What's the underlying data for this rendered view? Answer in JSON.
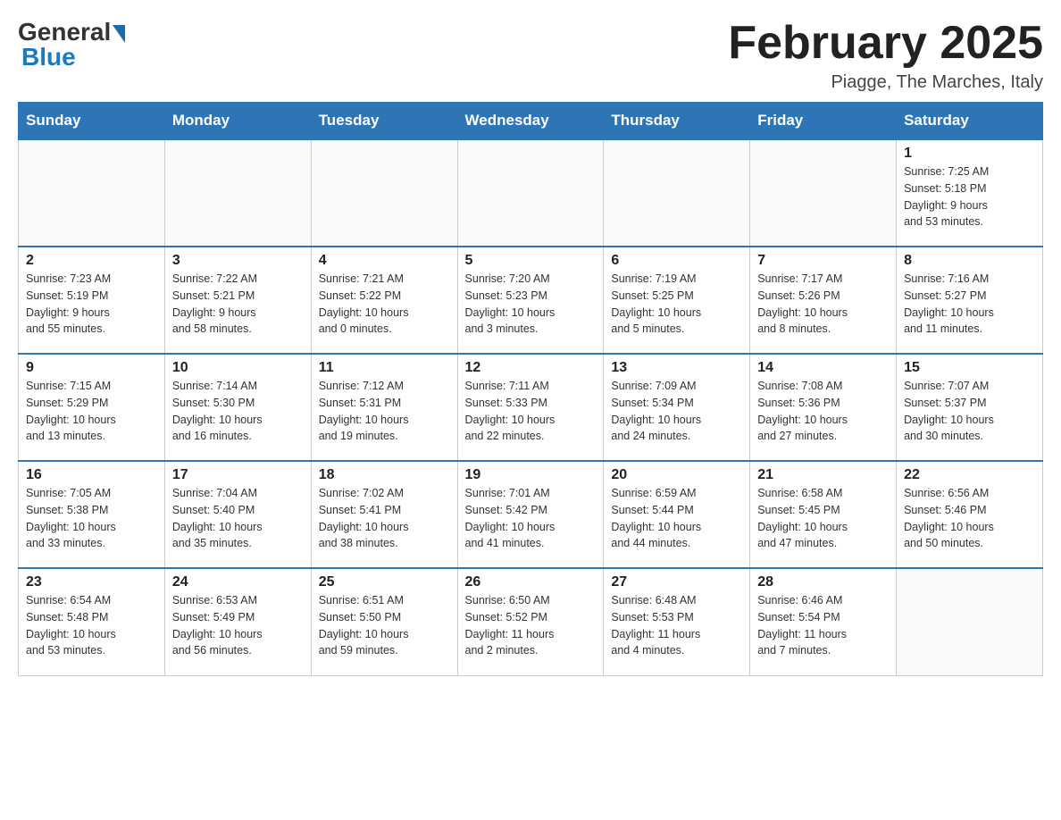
{
  "header": {
    "logo_general": "General",
    "logo_blue": "Blue",
    "month_title": "February 2025",
    "location": "Piagge, The Marches, Italy"
  },
  "weekdays": [
    "Sunday",
    "Monday",
    "Tuesday",
    "Wednesday",
    "Thursday",
    "Friday",
    "Saturday"
  ],
  "weeks": [
    [
      {
        "day": "",
        "info": ""
      },
      {
        "day": "",
        "info": ""
      },
      {
        "day": "",
        "info": ""
      },
      {
        "day": "",
        "info": ""
      },
      {
        "day": "",
        "info": ""
      },
      {
        "day": "",
        "info": ""
      },
      {
        "day": "1",
        "info": "Sunrise: 7:25 AM\nSunset: 5:18 PM\nDaylight: 9 hours\nand 53 minutes."
      }
    ],
    [
      {
        "day": "2",
        "info": "Sunrise: 7:23 AM\nSunset: 5:19 PM\nDaylight: 9 hours\nand 55 minutes."
      },
      {
        "day": "3",
        "info": "Sunrise: 7:22 AM\nSunset: 5:21 PM\nDaylight: 9 hours\nand 58 minutes."
      },
      {
        "day": "4",
        "info": "Sunrise: 7:21 AM\nSunset: 5:22 PM\nDaylight: 10 hours\nand 0 minutes."
      },
      {
        "day": "5",
        "info": "Sunrise: 7:20 AM\nSunset: 5:23 PM\nDaylight: 10 hours\nand 3 minutes."
      },
      {
        "day": "6",
        "info": "Sunrise: 7:19 AM\nSunset: 5:25 PM\nDaylight: 10 hours\nand 5 minutes."
      },
      {
        "day": "7",
        "info": "Sunrise: 7:17 AM\nSunset: 5:26 PM\nDaylight: 10 hours\nand 8 minutes."
      },
      {
        "day": "8",
        "info": "Sunrise: 7:16 AM\nSunset: 5:27 PM\nDaylight: 10 hours\nand 11 minutes."
      }
    ],
    [
      {
        "day": "9",
        "info": "Sunrise: 7:15 AM\nSunset: 5:29 PM\nDaylight: 10 hours\nand 13 minutes."
      },
      {
        "day": "10",
        "info": "Sunrise: 7:14 AM\nSunset: 5:30 PM\nDaylight: 10 hours\nand 16 minutes."
      },
      {
        "day": "11",
        "info": "Sunrise: 7:12 AM\nSunset: 5:31 PM\nDaylight: 10 hours\nand 19 minutes."
      },
      {
        "day": "12",
        "info": "Sunrise: 7:11 AM\nSunset: 5:33 PM\nDaylight: 10 hours\nand 22 minutes."
      },
      {
        "day": "13",
        "info": "Sunrise: 7:09 AM\nSunset: 5:34 PM\nDaylight: 10 hours\nand 24 minutes."
      },
      {
        "day": "14",
        "info": "Sunrise: 7:08 AM\nSunset: 5:36 PM\nDaylight: 10 hours\nand 27 minutes."
      },
      {
        "day": "15",
        "info": "Sunrise: 7:07 AM\nSunset: 5:37 PM\nDaylight: 10 hours\nand 30 minutes."
      }
    ],
    [
      {
        "day": "16",
        "info": "Sunrise: 7:05 AM\nSunset: 5:38 PM\nDaylight: 10 hours\nand 33 minutes."
      },
      {
        "day": "17",
        "info": "Sunrise: 7:04 AM\nSunset: 5:40 PM\nDaylight: 10 hours\nand 35 minutes."
      },
      {
        "day": "18",
        "info": "Sunrise: 7:02 AM\nSunset: 5:41 PM\nDaylight: 10 hours\nand 38 minutes."
      },
      {
        "day": "19",
        "info": "Sunrise: 7:01 AM\nSunset: 5:42 PM\nDaylight: 10 hours\nand 41 minutes."
      },
      {
        "day": "20",
        "info": "Sunrise: 6:59 AM\nSunset: 5:44 PM\nDaylight: 10 hours\nand 44 minutes."
      },
      {
        "day": "21",
        "info": "Sunrise: 6:58 AM\nSunset: 5:45 PM\nDaylight: 10 hours\nand 47 minutes."
      },
      {
        "day": "22",
        "info": "Sunrise: 6:56 AM\nSunset: 5:46 PM\nDaylight: 10 hours\nand 50 minutes."
      }
    ],
    [
      {
        "day": "23",
        "info": "Sunrise: 6:54 AM\nSunset: 5:48 PM\nDaylight: 10 hours\nand 53 minutes."
      },
      {
        "day": "24",
        "info": "Sunrise: 6:53 AM\nSunset: 5:49 PM\nDaylight: 10 hours\nand 56 minutes."
      },
      {
        "day": "25",
        "info": "Sunrise: 6:51 AM\nSunset: 5:50 PM\nDaylight: 10 hours\nand 59 minutes."
      },
      {
        "day": "26",
        "info": "Sunrise: 6:50 AM\nSunset: 5:52 PM\nDaylight: 11 hours\nand 2 minutes."
      },
      {
        "day": "27",
        "info": "Sunrise: 6:48 AM\nSunset: 5:53 PM\nDaylight: 11 hours\nand 4 minutes."
      },
      {
        "day": "28",
        "info": "Sunrise: 6:46 AM\nSunset: 5:54 PM\nDaylight: 11 hours\nand 7 minutes."
      },
      {
        "day": "",
        "info": ""
      }
    ]
  ]
}
